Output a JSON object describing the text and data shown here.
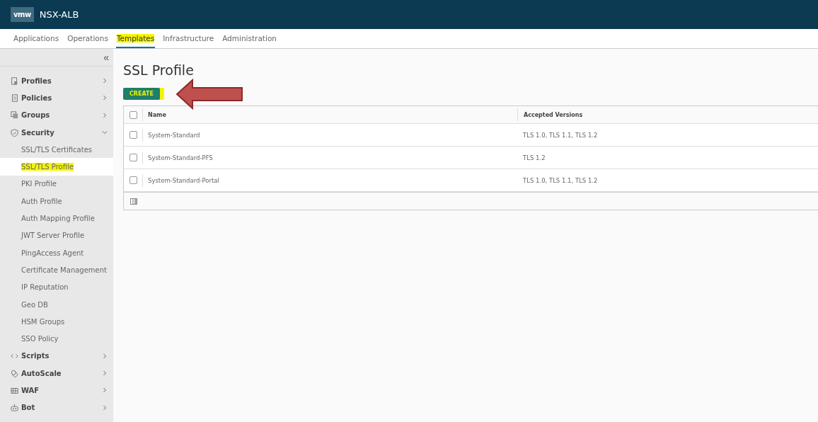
{
  "header": {
    "logo": "vmw",
    "title": "NSX-ALB"
  },
  "nav_tabs": [
    {
      "label": "Applications",
      "selected": false,
      "highlighted": false
    },
    {
      "label": "Operations",
      "selected": false,
      "highlighted": false
    },
    {
      "label": "Templates",
      "selected": true,
      "highlighted": true
    },
    {
      "label": "Infrastructure",
      "selected": false,
      "highlighted": false
    },
    {
      "label": "Administration",
      "selected": false,
      "highlighted": false
    }
  ],
  "sidebar": {
    "collapse_icon": "«",
    "items": [
      {
        "label": "Profiles",
        "expanded": false
      },
      {
        "label": "Policies",
        "expanded": false
      },
      {
        "label": "Groups",
        "expanded": false
      },
      {
        "label": "Security",
        "expanded": true,
        "children": [
          {
            "label": "SSL/TLS Certificates",
            "selected": false,
            "highlighted": false
          },
          {
            "label": "SSL/TLS Profile",
            "selected": true,
            "highlighted": true
          },
          {
            "label": "PKI Profile",
            "selected": false,
            "highlighted": false
          },
          {
            "label": "Auth Profile",
            "selected": false,
            "highlighted": false
          },
          {
            "label": "Auth Mapping Profile",
            "selected": false,
            "highlighted": false
          },
          {
            "label": "JWT Server Profile",
            "selected": false,
            "highlighted": false
          },
          {
            "label": "PingAccess Agent",
            "selected": false,
            "highlighted": false
          },
          {
            "label": "Certificate Management",
            "selected": false,
            "highlighted": false
          },
          {
            "label": "IP Reputation",
            "selected": false,
            "highlighted": false
          },
          {
            "label": "Geo DB",
            "selected": false,
            "highlighted": false
          },
          {
            "label": "HSM Groups",
            "selected": false,
            "highlighted": false
          },
          {
            "label": "SSO Policy",
            "selected": false,
            "highlighted": false
          }
        ]
      },
      {
        "label": "Scripts",
        "expanded": false
      },
      {
        "label": "AutoScale",
        "expanded": false
      },
      {
        "label": "WAF",
        "expanded": false
      },
      {
        "label": "Bot",
        "expanded": false
      }
    ]
  },
  "page": {
    "title": "SSL Profile",
    "create_button": {
      "label": "CREATE",
      "highlighted": true
    }
  },
  "table": {
    "select_all_checked": false,
    "columns": [
      "Name",
      "Accepted Versions"
    ],
    "rows": [
      {
        "name": "System-Standard",
        "accepted_versions": "TLS 1.0, TLS 1.1, TLS 1.2",
        "checked": false
      },
      {
        "name": "System-Standard-PFS",
        "accepted_versions": "TLS 1.2",
        "checked": false
      },
      {
        "name": "System-Standard-Portal",
        "accepted_versions": "TLS 1.0, TLS 1.1, TLS 1.2",
        "checked": false
      }
    ]
  }
}
